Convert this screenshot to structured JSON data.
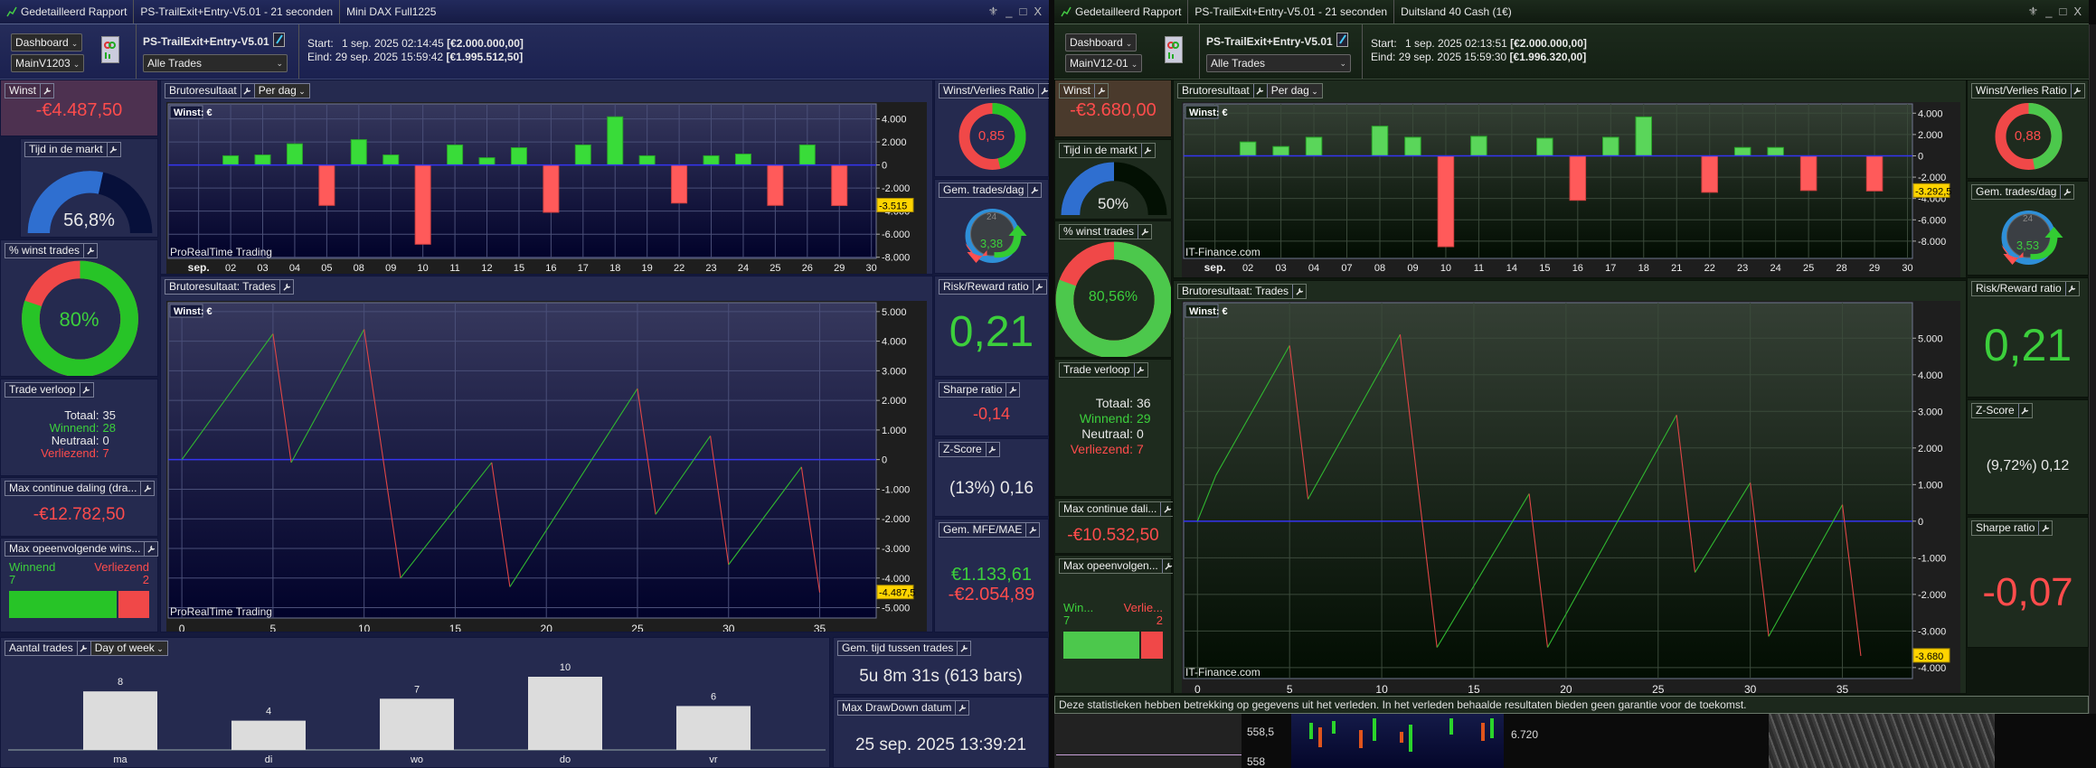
{
  "windows": [
    {
      "theme": "blue",
      "title": {
        "app": "Gedetailleerd Rapport",
        "strategy": "PS-TrailExit+Entry-V5.01 - 21 seconden",
        "instrument": "Mini DAX Full1225"
      },
      "toolbar": {
        "dashboard": "Dashboard",
        "layout": "MainV1203",
        "strategy_name": "PS-TrailExit+Entry-V5.01",
        "filter": "Alle Trades",
        "start_label": "Start:",
        "start_value": "1 sep. 2025 02:14:45",
        "start_capital": "[€2.000.000,00]",
        "end_label": "Eind:",
        "end_value": "29 sep. 2025 15:59:42",
        "end_capital": "[€1.995.512,50]"
      },
      "stats": {
        "winst": {
          "label": "Winst",
          "value": "-€4.487,50"
        },
        "tijd": {
          "label": "Tijd in de markt",
          "value": "56,8%",
          "fraction": 0.568
        },
        "winst_trades": {
          "label": "% winst trades",
          "value": "80%",
          "fraction": 0.8
        },
        "trade_verloop": {
          "label": "Trade verloop",
          "rows": [
            {
              "label": "Totaal:",
              "value": "35",
              "tone": "wht"
            },
            {
              "label": "Winnend:",
              "value": "28",
              "tone": "grn"
            },
            {
              "label": "Neutraal:",
              "value": "0",
              "tone": "wht"
            },
            {
              "label": "Verliezend:",
              "value": "7",
              "tone": "red"
            }
          ]
        },
        "max_daling": {
          "label": "Max continue daling (dra...",
          "value": "-€12.782,50"
        },
        "max_opeenv": {
          "label": "Max opeenvolgende wins...",
          "win_label": "Winnend",
          "win": "7",
          "loss_label": "Verliezend",
          "loss": "2"
        },
        "wvr": {
          "label": "Winst/Verlies Ratio",
          "value": "0,85",
          "green_fraction": 0.46
        },
        "gem_trades": {
          "label": "Gem. trades/dag",
          "value": "3,38",
          "dial": "24"
        },
        "rr": {
          "label": "Risk/Reward ratio",
          "value": "0,21"
        },
        "sharpe": {
          "label": "Sharpe ratio",
          "value": "-0,14"
        },
        "zscore": {
          "label": "Z-Score",
          "value": "(13%) 0,16"
        },
        "mfe": {
          "label": "Gem. MFE/MAE",
          "mfe": "€1.133,61",
          "mae": "-€2.054,89"
        }
      },
      "bottom": {
        "gem_tijd": {
          "label": "Gem. tijd tussen trades",
          "value": "5u 8m 31s (613 bars)"
        },
        "max_dd_datum": {
          "label": "Max DrawDown datum",
          "value": "25 sep. 2025 13:39:21"
        }
      }
    },
    {
      "theme": "green",
      "title": {
        "app": "Gedetailleerd Rapport",
        "strategy": "PS-TrailExit+Entry-V5.01 - 21 seconden",
        "instrument": "Duitsland 40 Cash (1€)"
      },
      "toolbar": {
        "dashboard": "Dashboard",
        "layout": "MainV12-01",
        "strategy_name": "PS-TrailExit+Entry-V5.01",
        "filter": "Alle Trades",
        "start_label": "Start:",
        "start_value": "1 sep. 2025 02:13:51",
        "start_capital": "[€2.000.000,00]",
        "end_label": "Eind:",
        "end_value": "29 sep. 2025 15:59:30",
        "end_capital": "[€1.996.320,00]"
      },
      "stats": {
        "winst": {
          "label": "Winst",
          "value": "-€3.680,00"
        },
        "tijd": {
          "label": "Tijd in de markt",
          "value": "50%",
          "fraction": 0.5
        },
        "winst_trades": {
          "label": "% winst trades",
          "value": "80,56%",
          "fraction": 0.8056
        },
        "trade_verloop": {
          "label": "Trade verloop",
          "rows": [
            {
              "label": "Totaal:",
              "value": "36",
              "tone": "wht"
            },
            {
              "label": "Winnend:",
              "value": "29",
              "tone": "grn"
            },
            {
              "label": "Neutraal:",
              "value": "0",
              "tone": "wht"
            },
            {
              "label": "Verliezend:",
              "value": "7",
              "tone": "red"
            }
          ]
        },
        "max_daling": {
          "label": "Max continue dali...",
          "value": "-€10.532,50"
        },
        "max_opeenv": {
          "label": "Max opeenvolgen...",
          "win_label": "Win...",
          "win": "7",
          "loss_label": "Verlie...",
          "loss": "2"
        },
        "wvr": {
          "label": "Winst/Verlies Ratio",
          "value": "0,88",
          "green_fraction": 0.47
        },
        "gem_trades": {
          "label": "Gem. trades/dag",
          "value": "3,53",
          "dial": "24"
        },
        "rr": {
          "label": "Risk/Reward ratio",
          "value": "0,21"
        },
        "zscore": {
          "label": "Z-Score",
          "value": "(9,72%) 0,12"
        },
        "sharpe": {
          "label": "Sharpe ratio",
          "value": "-0,07"
        }
      },
      "footer": "Deze statistieken hebben betrekking op gegevens uit het verleden. In het verleden behaalde resultaten bieden geen garantie voor de toekomst."
    }
  ],
  "background": {
    "price_a": "558,5",
    "price_b": "558",
    "price_c": "6.720"
  },
  "chart_data": [
    {
      "id": "left-daily",
      "type": "bar",
      "title": "Brutoresultaat",
      "period": "Per dag",
      "unit_label": "Winst: €",
      "watermark": "ProRealTime Trading",
      "month": "sep.",
      "categories": [
        "02",
        "03",
        "04",
        "05",
        "08",
        "09",
        "10",
        "11",
        "12",
        "15",
        "16",
        "17",
        "18",
        "19",
        "22",
        "23",
        "24",
        "25",
        "26",
        "29",
        "30"
      ],
      "values": [
        800,
        870,
        1840,
        -3500,
        2200,
        870,
        -6870,
        1740,
        630,
        1500,
        -4100,
        1740,
        4180,
        800,
        -3300,
        800,
        950,
        -3500,
        1740,
        -3515,
        0
      ],
      "ylim": [
        -8100,
        5300
      ],
      "yticks": [
        4000,
        2000,
        0,
        -2000,
        -4000,
        -6000,
        -8000
      ],
      "ytick_labels": [
        "4.000",
        "2.000",
        "0",
        "-2.000",
        "-4.000",
        "-6.000",
        "-8.000"
      ],
      "last_label": "-3.515",
      "last_value": -3515
    },
    {
      "id": "left-trades",
      "type": "line",
      "title": "Brutoresultaat: Trades",
      "unit_label": "Winst: €",
      "watermark": "ProRealTime Trading",
      "points": [
        [
          0,
          0
        ],
        [
          5,
          4250
        ],
        [
          6,
          -100
        ],
        [
          10,
          4400
        ],
        [
          12,
          -4000
        ],
        [
          17,
          -100
        ],
        [
          18,
          -4300
        ],
        [
          25,
          2400
        ],
        [
          26,
          -1850
        ],
        [
          29,
          800
        ],
        [
          30,
          -3550
        ],
        [
          34,
          -250
        ],
        [
          35,
          -4487.5
        ]
      ],
      "xlim": [
        -0.75,
        38.1
      ],
      "xticks": [
        0,
        5,
        10,
        15,
        20,
        25,
        30,
        35
      ],
      "ylim": [
        -5350,
        5300
      ],
      "yticks": [
        5000,
        4000,
        3000,
        2000,
        1000,
        0,
        -1000,
        -2000,
        -3000,
        -4000,
        -5000
      ],
      "ytick_labels": [
        "5.000",
        "4.000",
        "3.000",
        "2.000",
        "1.000",
        "0",
        "-1.000",
        "-2.000",
        "-3.000",
        "-4.000",
        "-5.000"
      ],
      "last_label": "-4.487,5",
      "last_value": -4487.5
    },
    {
      "id": "left-dow",
      "type": "bar",
      "title": "Aantal trades",
      "period": "Day of week",
      "categories": [
        "ma",
        "di",
        "wo",
        "do",
        "vr"
      ],
      "values": [
        8,
        4,
        7,
        10,
        6
      ]
    },
    {
      "id": "right-daily",
      "type": "bar",
      "title": "Brutoresultaat",
      "period": "Per dag",
      "unit_label": "Winst: €",
      "watermark": "IT-Finance.com",
      "month": "sep.",
      "categories": [
        "02",
        "03",
        "04",
        "07",
        "08",
        "09",
        "10",
        "11",
        "14",
        "15",
        "16",
        "17",
        "18",
        "21",
        "22",
        "23",
        "24",
        "25",
        "28",
        "29",
        "30"
      ],
      "values": [
        1300,
        870,
        1740,
        0,
        2780,
        1740,
        -8520,
        1830,
        0,
        1650,
        -4170,
        1740,
        3650,
        0,
        -3420,
        780,
        780,
        -3250,
        0,
        -3292.5,
        0
      ],
      "ylim": [
        -9620,
        4870
      ],
      "yticks": [
        4000,
        2000,
        0,
        -2000,
        -4000,
        -6000,
        -8000
      ],
      "ytick_labels": [
        "4.000",
        "2.000",
        "0",
        "-2.000",
        "-4.000",
        "-6.000",
        "-8.000"
      ],
      "last_label": "-3.292,5",
      "last_value": -3292.5
    },
    {
      "id": "right-trades",
      "type": "line",
      "title": "Brutoresultaat: Trades",
      "unit_label": "Winst: €",
      "watermark": "IT-Finance.com",
      "points": [
        [
          0,
          0
        ],
        [
          1,
          1250
        ],
        [
          5,
          4800
        ],
        [
          6,
          600
        ],
        [
          11,
          5100
        ],
        [
          13,
          -3450
        ],
        [
          18,
          750
        ],
        [
          19,
          -3450
        ],
        [
          26,
          2900
        ],
        [
          27,
          -1400
        ],
        [
          30,
          1050
        ],
        [
          31,
          -3150
        ],
        [
          35,
          450
        ],
        [
          36,
          -3680
        ]
      ],
      "xlim": [
        -0.75,
        38.8
      ],
      "xticks": [
        0,
        5,
        10,
        15,
        20,
        25,
        30,
        35
      ],
      "ylim": [
        -4300,
        5970
      ],
      "yticks": [
        5000,
        4000,
        3000,
        2000,
        1000,
        0,
        -1000,
        -2000,
        -3000,
        -4000
      ],
      "ytick_labels": [
        "5.000",
        "4.000",
        "3.000",
        "2.000",
        "1.000",
        "0",
        "-1.000",
        "-2.000",
        "-3.000",
        "-4.000"
      ],
      "last_label": "-3.680",
      "last_value": -3680
    }
  ]
}
